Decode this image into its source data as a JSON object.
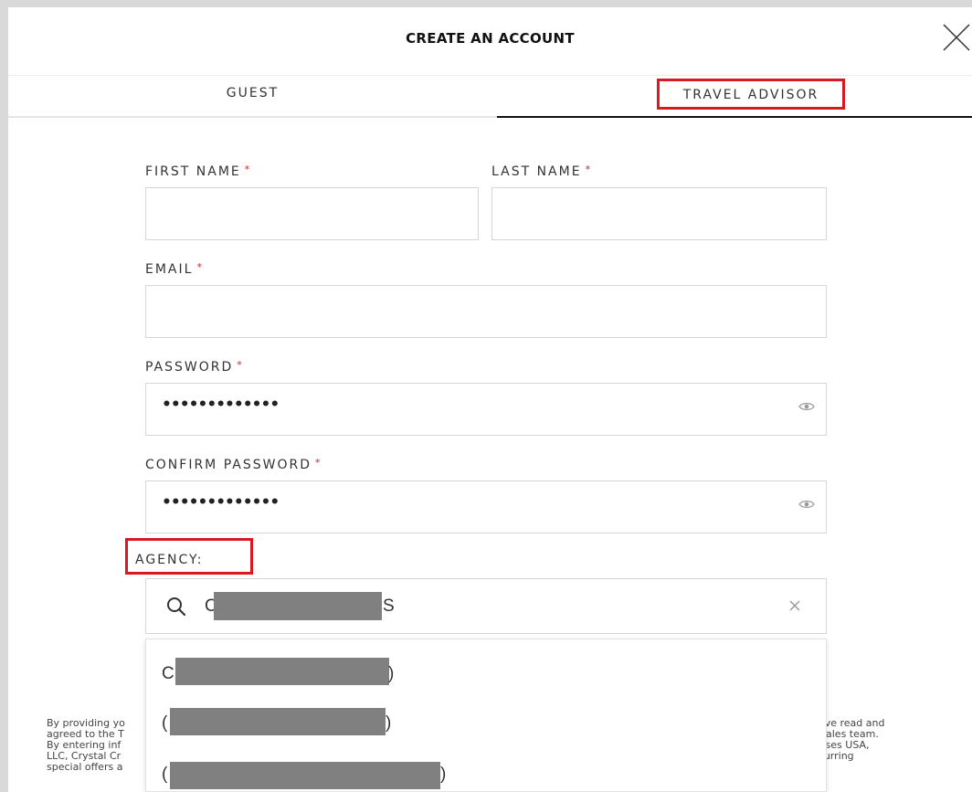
{
  "modal": {
    "title": "CREATE AN ACCOUNT",
    "close_icon": "close-icon"
  },
  "tabs": [
    {
      "label": "GUEST",
      "selected": false
    },
    {
      "label": "TRAVEL ADVISOR",
      "selected": true
    }
  ],
  "form": {
    "first_name": {
      "label": "FIRST NAME",
      "required_mark": "*",
      "value": ""
    },
    "last_name": {
      "label": "LAST NAME",
      "required_mark": "*",
      "value": ""
    },
    "email": {
      "label": "EMAIL",
      "required_mark": "*",
      "value": ""
    },
    "password": {
      "label": "PASSWORD",
      "required_mark": "*",
      "masked_value": "•••••••••••••",
      "toggle_icon": "eye-icon"
    },
    "confirm_password": {
      "label": "CONFIRM PASSWORD",
      "required_mark": "*",
      "masked_value": "•••••••••••••",
      "toggle_icon": "eye-icon"
    },
    "agency": {
      "label": "AGENCY:",
      "search_icon": "search-icon",
      "clear_icon": "close-icon",
      "visible_value_start": "C",
      "visible_value_end": "S",
      "value_redacted": true
    }
  },
  "agency_results": [
    {
      "visible_start": "C",
      "visible_end": ")",
      "redacted": true
    },
    {
      "visible_start": "(",
      "visible_end": ")",
      "redacted": true
    },
    {
      "visible_start": "(",
      "visible_end": ")",
      "redacted": true
    }
  ],
  "disclaimer": {
    "left_lines": [
      "By providing yo",
      "agreed to the T",
      "By entering inf",
      "LLC, Crystal Cr",
      "special offers a"
    ],
    "right_lines": [
      "have read and",
      "r Sales team.",
      "ruises USA,",
      "ecurring",
      ""
    ]
  },
  "colors": {
    "highlight": "#d71920",
    "required": "#c62828",
    "active_tab_underline": "#111111",
    "redaction": "#808080"
  }
}
